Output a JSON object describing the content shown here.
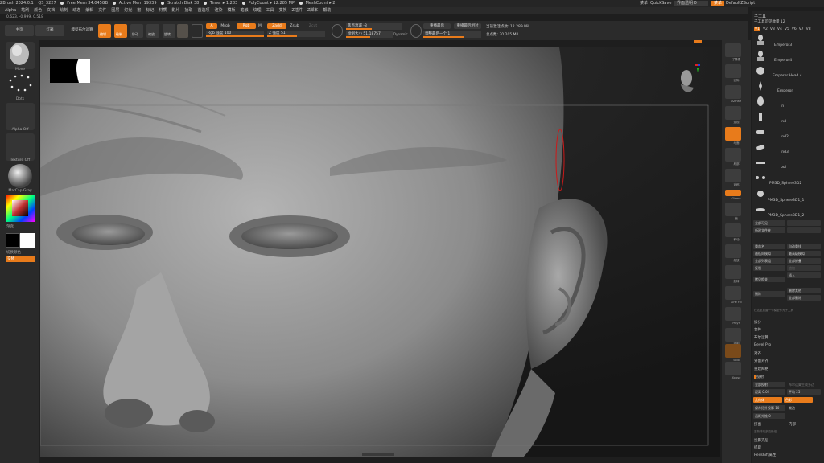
{
  "titlebar": {
    "app": "ZBrush 2024.0.1",
    "qs": "QS_3227",
    "free_mem": "Free Mem 34.045GB",
    "active_mem": "Active Mem 19339",
    "scratch": "Scratch Disk 38",
    "timer": "Timer ▸ 1.283",
    "polycount": "PolyCount ▸ 12.285 MP",
    "meshcount": "MeshCount ▸ 2",
    "menu_right": [
      "菜单",
      "QuickSave",
      "界面透明 0"
    ],
    "menus_btn": "菜单",
    "default_script": "DefaultZScript"
  },
  "menubar": [
    "Alpha",
    "笔刷",
    "颜色",
    "文档",
    "绘制",
    "动态",
    "编辑",
    "文件",
    "图层",
    "灯光",
    "宏",
    "标记",
    "材质",
    "影片",
    "拾取",
    "首选项",
    "渲染",
    "模板",
    "笔触",
    "纹理",
    "工具",
    "变换",
    "Z插件",
    "Z脚本",
    "帮助"
  ],
  "coords": "0.623, -0.999, 0.518",
  "toolbar": {
    "lightbox": "主页",
    "projection": "灯箱",
    "liveboolean": "模型布尔运算",
    "edit": "编辑",
    "draw": "绘制",
    "move": "移动",
    "scale": "缩放",
    "rotate": "旋转",
    "a_label": "A",
    "mrgb": "Mrgb",
    "rgb": "Rgb",
    "m": "M",
    "zadd": "Zadd",
    "zsub": "Zsub",
    "zcut": "Zcut",
    "rgb_intensity": "Rgb 强度 100",
    "z_intensity": "Z 强度 51",
    "focal_shift": "焦点衰减 -8",
    "draw_size": "绘制大小 51.18757",
    "dynamic": "Dynamic",
    "last_btn1": "重播最后",
    "last_btn2": "重播最后相对",
    "adjust": "调整最后一个 1",
    "active_points": "当前激活点数: 12.289 Mil",
    "total_points": "总点数: 30.205 Mil"
  },
  "leftshelf": {
    "brush": "Move",
    "stroke": "Dots",
    "alpha": "Alpha Off",
    "texture": "Texture Off",
    "material": "MatCap Gray",
    "gradient": "渐变",
    "switch": "切换颜色",
    "alternate": "交替"
  },
  "rightshelf": [
    "子像素",
    "实际",
    "AAHalf",
    "透视",
    "地面",
    "局部",
    "对称",
    "Gizmo",
    "帧",
    "移动",
    "缩放",
    "旋转",
    "Line Fill",
    "PolyF",
    "透明",
    "Solo",
    "Xpose"
  ],
  "toolpanel": {
    "title": "子工具",
    "subtitle": "子工具可见数量 12",
    "versions": [
      "V1",
      "V2",
      "V3",
      "V4",
      "V5",
      "V6",
      "V7",
      "V8"
    ],
    "items": [
      "Emperor3",
      "Emperor4",
      "Emperor Head 4",
      "Emperor",
      "ln",
      "ind",
      "ind2",
      "ind3",
      "bol",
      "PM3D_Sphere3D2",
      "PM3D_Sphere3D1_1",
      "PM3D_Sphere3D1_2"
    ],
    "rows": [
      [
        "全部可见",
        ""
      ],
      [
        "新建文件夹",
        ""
      ],
      [
        "重命名",
        "自动重排"
      ],
      [
        "最低向模拟",
        "最高级模拟"
      ],
      [
        "全部列表组",
        "全部折叠"
      ],
      [
        "复制",
        "追加"
      ],
      [
        "拷贝相关",
        "插入"
      ],
      [
        "删除",
        "删除其他"
      ],
      [
        "",
        "全部删除"
      ]
    ],
    "merge_hint": "在这里放置一个模型作为子工具",
    "sections": [
      "拆分",
      "合并",
      "布尔运算",
      "Bevel Pro",
      "对齐",
      "分割对齐",
      "重建网格",
      "投射"
    ],
    "project_all": "全部投射",
    "auto_remesh": "布尔运算生成多边",
    "distance": "距离 0.02",
    "mean": "平均 25",
    "geometry": "几何体",
    "color": "色彩",
    "polygroup_proj": "保存拓扑投影 10",
    "expand": "裁边",
    "offset": "远距外推 0",
    "extract": "挤出",
    "inner": "内部",
    "poly_labels": "重新排列多边形组",
    "projection_shell": "投影壳层",
    "extract2": "提取",
    "redshift": "Redshift属性"
  }
}
